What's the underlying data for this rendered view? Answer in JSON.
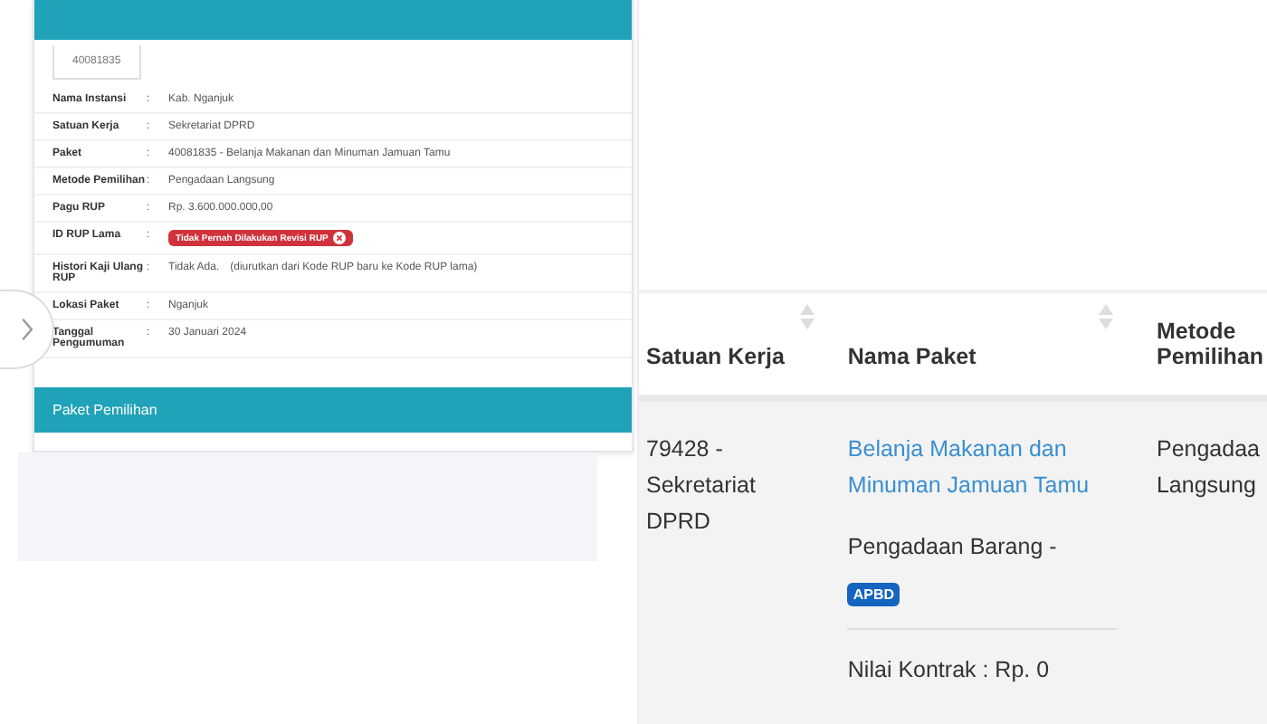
{
  "detail_panel": {
    "tab": "40081835",
    "rows": [
      {
        "label": "Nama Instansi",
        "separator": ":",
        "value": "Kab. Nganjuk",
        "kind": "text"
      },
      {
        "label": "Satuan Kerja",
        "separator": ":",
        "value": "Sekretariat DPRD",
        "kind": "text"
      },
      {
        "label": "Paket",
        "separator": ":",
        "value": "40081835 - Belanja Makanan dan Minuman Jamuan Tamu",
        "kind": "text"
      },
      {
        "label": "Metode Pemilihan",
        "separator": ":",
        "value": "Pengadaan Langsung",
        "kind": "text"
      },
      {
        "label": "Pagu RUP",
        "separator": ":",
        "value": "Rp. 3.600.000.000,00",
        "kind": "text"
      },
      {
        "label": "ID RUP Lama",
        "separator": ":",
        "value": "Tidak Pernah Dilakukan Revisi RUP",
        "kind": "badge"
      },
      {
        "label": "Histori Kaji Ulang RUP",
        "separator": ":",
        "value": "Tidak Ada.",
        "note": "(diurutkan dari Kode RUP baru ke Kode RUP lama)",
        "kind": "text"
      },
      {
        "label": "Lokasi Paket",
        "separator": ":",
        "value": "Nganjuk",
        "kind": "text"
      },
      {
        "label": "Tanggal Pengumuman",
        "separator": ":",
        "value": "30 Januari 2024",
        "kind": "text"
      }
    ],
    "section_title": "Paket Pemilihan"
  },
  "table": {
    "columns": [
      "Satuan Kerja",
      "Nama Paket",
      "Metode Pemilihan"
    ],
    "rows": [
      {
        "satuan_kerja": "79428 - Sekretariat DPRD",
        "nama_paket": "Belanja Makanan dan Minuman Jamuan Tamu",
        "jenis": "Pengadaan Barang -",
        "sumber_dana": "APBD",
        "nilai_kontrak": "Nilai Kontrak : Rp. 0",
        "metode": "Pengadaa Langsung"
      }
    ]
  }
}
